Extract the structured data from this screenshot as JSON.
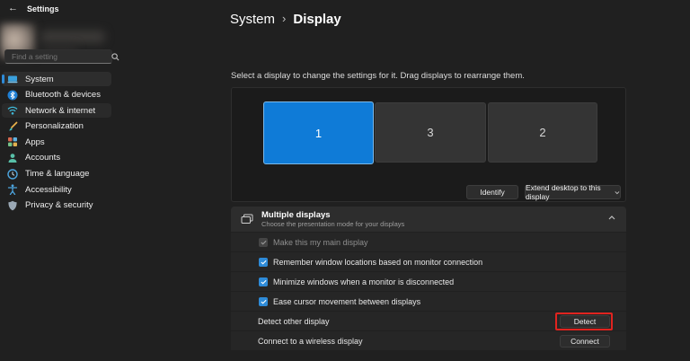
{
  "window": {
    "title": "Settings",
    "back_icon": "back-arrow"
  },
  "sidebar": {
    "search_placeholder": "Find a setting",
    "items": [
      {
        "label": "System",
        "selected": true
      },
      {
        "label": "Bluetooth & devices"
      },
      {
        "label": "Network & internet"
      },
      {
        "label": "Personalization"
      },
      {
        "label": "Apps"
      },
      {
        "label": "Accounts"
      },
      {
        "label": "Time & language"
      },
      {
        "label": "Accessibility"
      },
      {
        "label": "Privacy & security"
      }
    ]
  },
  "header": {
    "breadcrumb_parent": "System",
    "separator": "›",
    "title": "Display"
  },
  "display_section": {
    "instruction": "Select a display to change the settings for it. Drag displays to rearrange them.",
    "monitors": [
      {
        "number": "1",
        "selected": true
      },
      {
        "number": "3",
        "selected": false
      },
      {
        "number": "2",
        "selected": false
      }
    ],
    "identify_button": "Identify",
    "mode_dropdown_value": "Extend desktop to this display"
  },
  "multiple_displays": {
    "title": "Multiple displays",
    "subtitle": "Choose the presentation mode for your displays",
    "checkboxes": [
      {
        "label": "Make this my main display",
        "checked": true,
        "disabled": true
      },
      {
        "label": "Remember window locations based on monitor connection",
        "checked": true,
        "disabled": false
      },
      {
        "label": "Minimize windows when a monitor is disconnected",
        "checked": true,
        "disabled": false
      },
      {
        "label": "Ease cursor movement between displays",
        "checked": true,
        "disabled": false
      }
    ],
    "action_rows": [
      {
        "label": "Detect other display",
        "button": "Detect",
        "annotated": true
      },
      {
        "label": "Connect to a wireless display",
        "button": "Connect",
        "annotated": false
      }
    ]
  },
  "colors": {
    "accent": "#0f7bd7",
    "annotation_red": "#e0231f"
  }
}
